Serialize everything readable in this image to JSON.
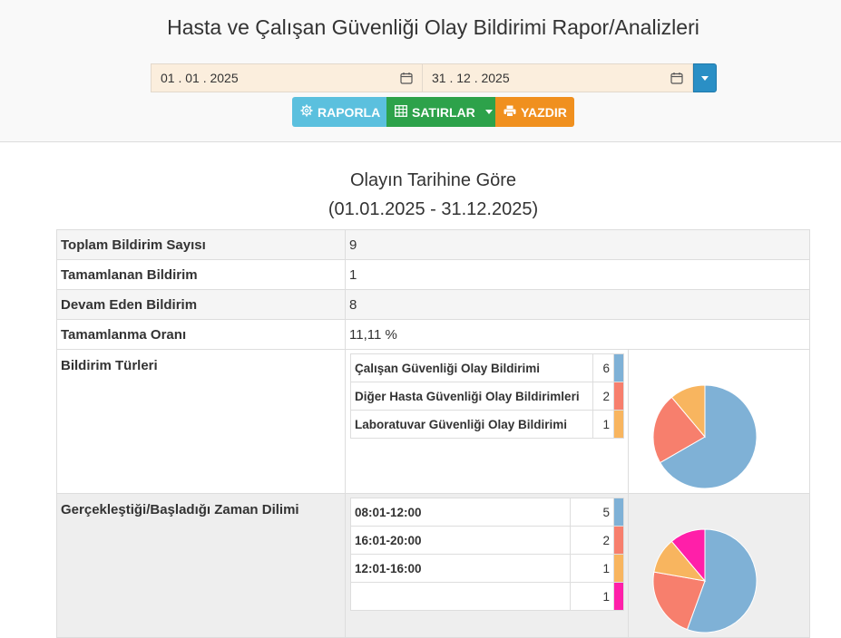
{
  "page_title": "Hasta ve Çalışan Güvenliği Olay Bildirimi Rapor/Analizleri",
  "filters": {
    "start_date": "01 . 01 . 2025",
    "end_date": "31 . 12 . 2025"
  },
  "toolbar": {
    "report_label": "RAPORLA",
    "rows_label": "SATIRLAR",
    "print_label": "YAZDIR"
  },
  "section": {
    "title": "Olayın Tarihine Göre",
    "range": "(01.01.2025 - 31.12.2025)"
  },
  "summary": [
    {
      "label": "Toplam Bildirim Sayısı",
      "value": "9"
    },
    {
      "label": "Tamamlanan Bildirim",
      "value": "1"
    },
    {
      "label": "Devam Eden Bildirim",
      "value": "8"
    },
    {
      "label": "Tamamlanma Oranı",
      "value": "11,11 %"
    }
  ],
  "types": {
    "label": "Bildirim Türleri",
    "rows": [
      {
        "name": "Çalışan Güvenliği Olay Bildirimi",
        "count": "6",
        "color": "#7fb1d6"
      },
      {
        "name": "Diğer Hasta Güvenliği Olay Bildirimleri",
        "count": "2",
        "color": "#f77f6d"
      },
      {
        "name": "Laboratuvar Güvenliği Olay Bildirimi",
        "count": "1",
        "color": "#f8b55f"
      }
    ]
  },
  "time": {
    "label": "Gerçekleştiği/Başladığı Zaman Dilimi",
    "rows": [
      {
        "name": "08:01-12:00",
        "count": "5",
        "color": "#7fb1d6"
      },
      {
        "name": "16:01-20:00",
        "count": "2",
        "color": "#f77f6d"
      },
      {
        "name": "12:01-16:00",
        "count": "1",
        "color": "#f8b55f"
      },
      {
        "name": "",
        "count": "1",
        "color": "#ff1fa9"
      }
    ]
  }
}
